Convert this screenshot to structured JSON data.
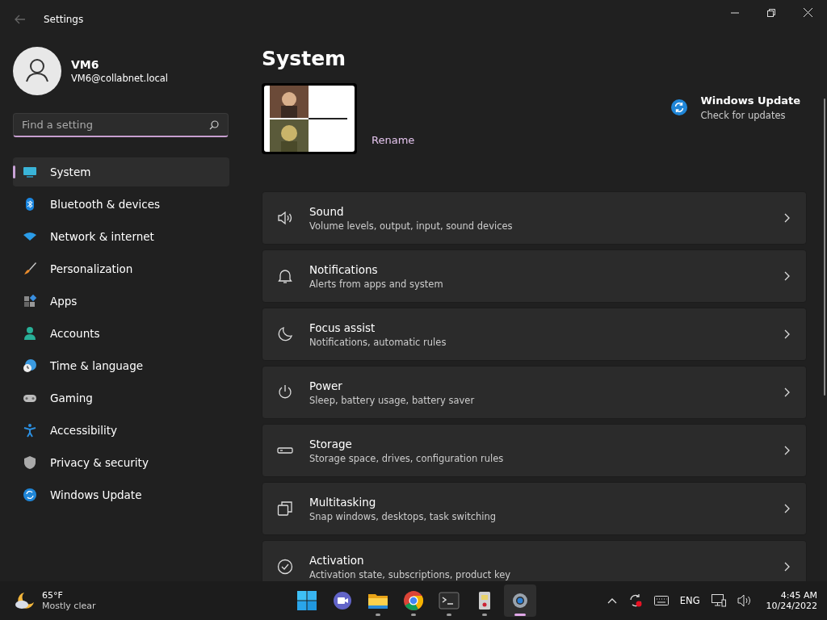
{
  "window": {
    "title": "Settings"
  },
  "account": {
    "name": "VM6",
    "email": "VM6@collabnet.local"
  },
  "search": {
    "placeholder": "Find a setting"
  },
  "nav": [
    {
      "label": "System",
      "selected": true
    },
    {
      "label": "Bluetooth & devices",
      "selected": false
    },
    {
      "label": "Network & internet",
      "selected": false
    },
    {
      "label": "Personalization",
      "selected": false
    },
    {
      "label": "Apps",
      "selected": false
    },
    {
      "label": "Accounts",
      "selected": false
    },
    {
      "label": "Time & language",
      "selected": false
    },
    {
      "label": "Gaming",
      "selected": false
    },
    {
      "label": "Accessibility",
      "selected": false
    },
    {
      "label": "Privacy & security",
      "selected": false
    },
    {
      "label": "Windows Update",
      "selected": false
    }
  ],
  "page": {
    "title": "System",
    "device": {
      "kind": "picture",
      "action": "Rename"
    },
    "update": {
      "title": "Windows Update",
      "subtitle": "Check for updates"
    },
    "cards": [
      {
        "title": "Sound",
        "subtitle": "Volume levels, output, input, sound devices"
      },
      {
        "title": "Notifications",
        "subtitle": "Alerts from apps and system"
      },
      {
        "title": "Focus assist",
        "subtitle": "Notifications, automatic rules"
      },
      {
        "title": "Power",
        "subtitle": "Sleep, battery usage, battery saver"
      },
      {
        "title": "Storage",
        "subtitle": "Storage space, drives, configuration rules"
      },
      {
        "title": "Multitasking",
        "subtitle": "Snap windows, desktops, task switching"
      },
      {
        "title": "Activation",
        "subtitle": "Activation state, subscriptions, product key"
      }
    ]
  },
  "taskbar": {
    "weather": {
      "temp": "65°F",
      "condition": "Mostly clear"
    },
    "apps": [
      {
        "running": false,
        "selected": false
      },
      {
        "running": false,
        "selected": false
      },
      {
        "running": true,
        "selected": false
      },
      {
        "running": true,
        "selected": false
      },
      {
        "running": true,
        "selected": false
      },
      {
        "running": true,
        "selected": false
      },
      {
        "running": true,
        "selected": true
      }
    ],
    "language": "ENG",
    "time": "4:45 AM",
    "date": "10/24/2022"
  }
}
